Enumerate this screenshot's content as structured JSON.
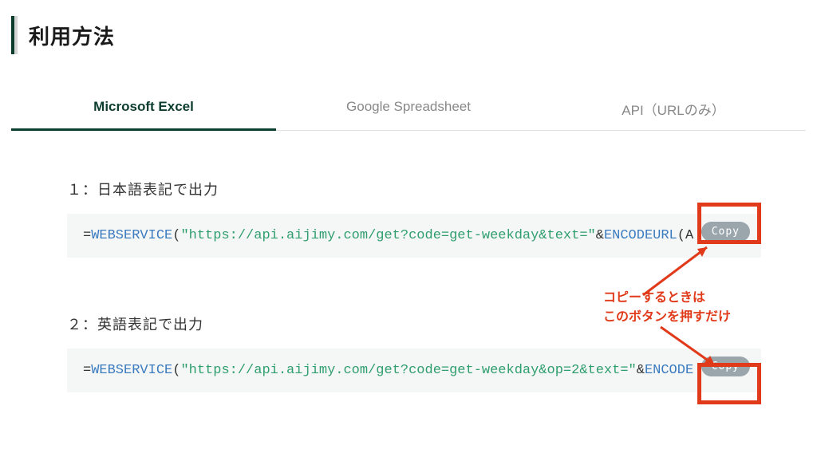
{
  "page_title": "利用方法",
  "tabs": {
    "tab1": "Microsoft Excel",
    "tab2": "Google Spreadsheet",
    "tab3": "API（URLのみ）"
  },
  "sections": {
    "s1_label": "１：日本語表記で出力",
    "s2_label": "２：英語表記で出力"
  },
  "code1": {
    "eq": "=",
    "fn": "WEBSERVICE",
    "open": "(",
    "str": "\"https://api.aijimy.com/get?code=get-weekday&text=\"",
    "amp": "&",
    "fn2": "ENCODEURL",
    "tail": "(A"
  },
  "code2": {
    "eq": "=",
    "fn": "WEBSERVICE",
    "open": "(",
    "str": "\"https://api.aijimy.com/get?code=get-weekday&op=2&text=\"",
    "amp": "&",
    "fn2": "ENCODE",
    "tail": ""
  },
  "copy_label": "Copy",
  "annotation_line1": "コピーするときは",
  "annotation_line2": "このボタンを押すだけ"
}
